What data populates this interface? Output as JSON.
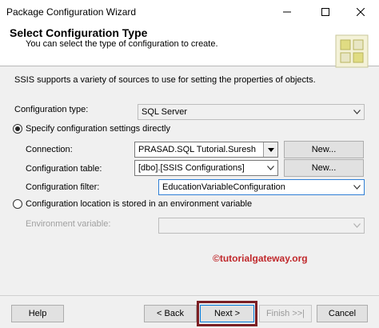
{
  "window": {
    "title": "Package Configuration Wizard"
  },
  "header": {
    "title": "Select Configuration Type",
    "subtitle": "You can select the type of configuration to create."
  },
  "intro_text": "SSIS supports a variety of sources to use for setting the properties of objects.",
  "configuration_type": {
    "label": "Configuration type:",
    "value": "SQL Server"
  },
  "specify_directly": {
    "label": "Specify configuration settings directly",
    "selected": true,
    "connection": {
      "label": "Connection:",
      "value": "PRASAD.SQL Tutorial.Suresh",
      "new_button": "New..."
    },
    "configuration_table": {
      "label": "Configuration table:",
      "value": "[dbo].[SSIS Configurations]",
      "new_button": "New..."
    },
    "configuration_filter": {
      "label": "Configuration filter:",
      "value": "EducationVariableConfiguration"
    }
  },
  "environment_option": {
    "label": "Configuration location is stored in an environment variable",
    "selected": false,
    "environment_variable": {
      "label": "Environment variable:",
      "value": ""
    }
  },
  "watermark": "©tutorialgateway.org",
  "footer": {
    "help": "Help",
    "back": "< Back",
    "next": "Next >",
    "finish": "Finish >>|",
    "cancel": "Cancel"
  },
  "colors": {
    "accent_blue": "#2f7fd6",
    "highlight_border": "#7b1f24",
    "watermark_red": "#c0282b"
  }
}
